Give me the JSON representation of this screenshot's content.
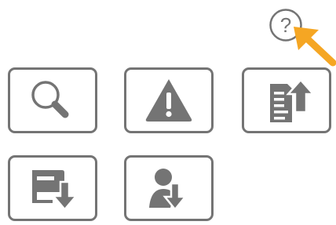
{
  "colors": {
    "icon_gray": "#747474",
    "frame_gray": "#747474",
    "background": "#ffffff",
    "pointer_orange": "#f5a623"
  },
  "help": {
    "glyph": "?",
    "icon": "question-mark-icon",
    "pointer_icon": "orange-arrow-icon"
  },
  "buttons": [
    {
      "name": "search-button",
      "icon": "magnifier-icon"
    },
    {
      "name": "warning-button",
      "icon": "warning-triangle-icon"
    },
    {
      "name": "upload-document-button",
      "icon": "document-upload-icon"
    },
    {
      "name": "download-card-button",
      "icon": "card-download-icon"
    },
    {
      "name": "download-user-button",
      "icon": "user-download-icon"
    }
  ]
}
